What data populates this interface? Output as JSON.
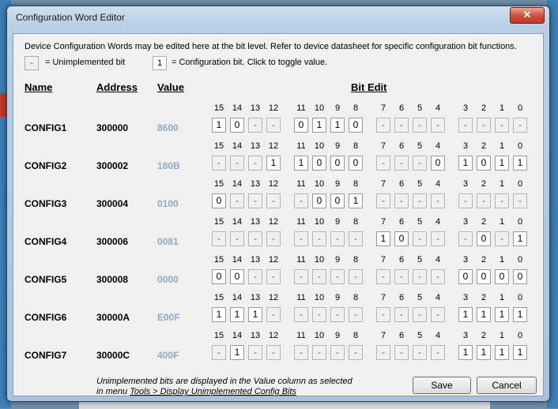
{
  "window": {
    "title": "Configuration Word Editor",
    "close_label": "✕"
  },
  "description": "Device Configuration Words may be edited here at the bit level.  Refer to device datasheet for specific configuration bit functions.",
  "legend": {
    "unimpl_symbol": "-",
    "unimpl_text": "= Unimplemented bit",
    "config_symbol": "1",
    "config_text": "= Configuration bit.  Click to toggle value."
  },
  "headers": {
    "name": "Name",
    "address": "Address",
    "value": "Value",
    "bitedit": "Bit Edit"
  },
  "bit_numbers": [
    "15",
    "14",
    "13",
    "12",
    "11",
    "10",
    "9",
    "8",
    "7",
    "6",
    "5",
    "4",
    "3",
    "2",
    "1",
    "0"
  ],
  "rows": [
    {
      "name": "CONFIG1",
      "address": "300000",
      "value": "8600",
      "bits": [
        "1",
        "0",
        "-",
        "-",
        "0",
        "1",
        "1",
        "0",
        "-",
        "-",
        "-",
        "-",
        "-",
        "-",
        "-",
        "-"
      ]
    },
    {
      "name": "CONFIG2",
      "address": "300002",
      "value": "180B",
      "bits": [
        "-",
        "-",
        "-",
        "1",
        "1",
        "0",
        "0",
        "0",
        "-",
        "-",
        "-",
        "0",
        "1",
        "0",
        "1",
        "1"
      ]
    },
    {
      "name": "CONFIG3",
      "address": "300004",
      "value": "0100",
      "bits": [
        "0",
        "-",
        "-",
        "-",
        "-",
        "0",
        "0",
        "1",
        "-",
        "-",
        "-",
        "-",
        "-",
        "-",
        "-",
        "-"
      ]
    },
    {
      "name": "CONFIG4",
      "address": "300006",
      "value": "0081",
      "bits": [
        "-",
        "-",
        "-",
        "-",
        "-",
        "-",
        "-",
        "-",
        "1",
        "0",
        "-",
        "-",
        "-",
        "0",
        "-",
        "1"
      ]
    },
    {
      "name": "CONFIG5",
      "address": "300008",
      "value": "0000",
      "bits": [
        "0",
        "0",
        "-",
        "-",
        "-",
        "-",
        "-",
        "-",
        "-",
        "-",
        "-",
        "-",
        "0",
        "0",
        "0",
        "0"
      ]
    },
    {
      "name": "CONFIG6",
      "address": "30000A",
      "value": "E00F",
      "bits": [
        "1",
        "1",
        "1",
        "-",
        "-",
        "-",
        "-",
        "-",
        "-",
        "-",
        "-",
        "-",
        "1",
        "1",
        "1",
        "1"
      ]
    },
    {
      "name": "CONFIG7",
      "address": "30000C",
      "value": "400F",
      "bits": [
        "-",
        "1",
        "-",
        "-",
        "-",
        "-",
        "-",
        "-",
        "-",
        "-",
        "-",
        "-",
        "1",
        "1",
        "1",
        "1"
      ]
    }
  ],
  "footnote": {
    "line1": "Unimplemented bits are displayed in the Value column as selected",
    "line2_prefix": "in menu  ",
    "line2_link": "Tools > Display Unimplemented Config Bits"
  },
  "buttons": {
    "save": "Save",
    "cancel": "Cancel"
  },
  "colors": {
    "value_text": "#8fa9c8",
    "close_red": "#c0392b"
  }
}
